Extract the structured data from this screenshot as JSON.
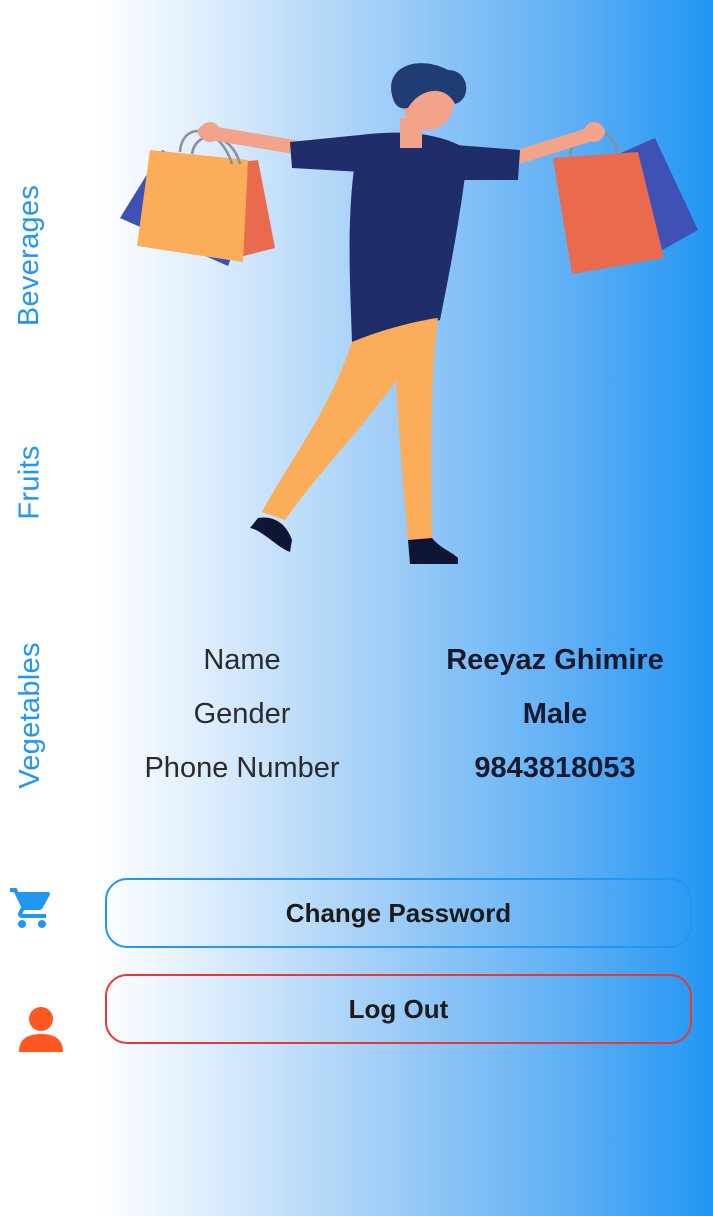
{
  "sidebar": {
    "tabs": [
      {
        "label": "Beverages"
      },
      {
        "label": "Fruits"
      },
      {
        "label": "Vegetables"
      }
    ],
    "cart_icon": "shopping-cart-icon",
    "profile_icon": "person-icon"
  },
  "profile": {
    "fields": [
      {
        "label": "Name",
        "value": "Reeyaz Ghimire"
      },
      {
        "label": "Gender",
        "value": "Male"
      },
      {
        "label": "Phone Number",
        "value": "9843818053"
      }
    ]
  },
  "actions": {
    "change_password": "Change Password",
    "logout": "Log Out"
  },
  "colors": {
    "accent": "#2196f3",
    "active": "#ff5722",
    "danger": "#e53935"
  }
}
